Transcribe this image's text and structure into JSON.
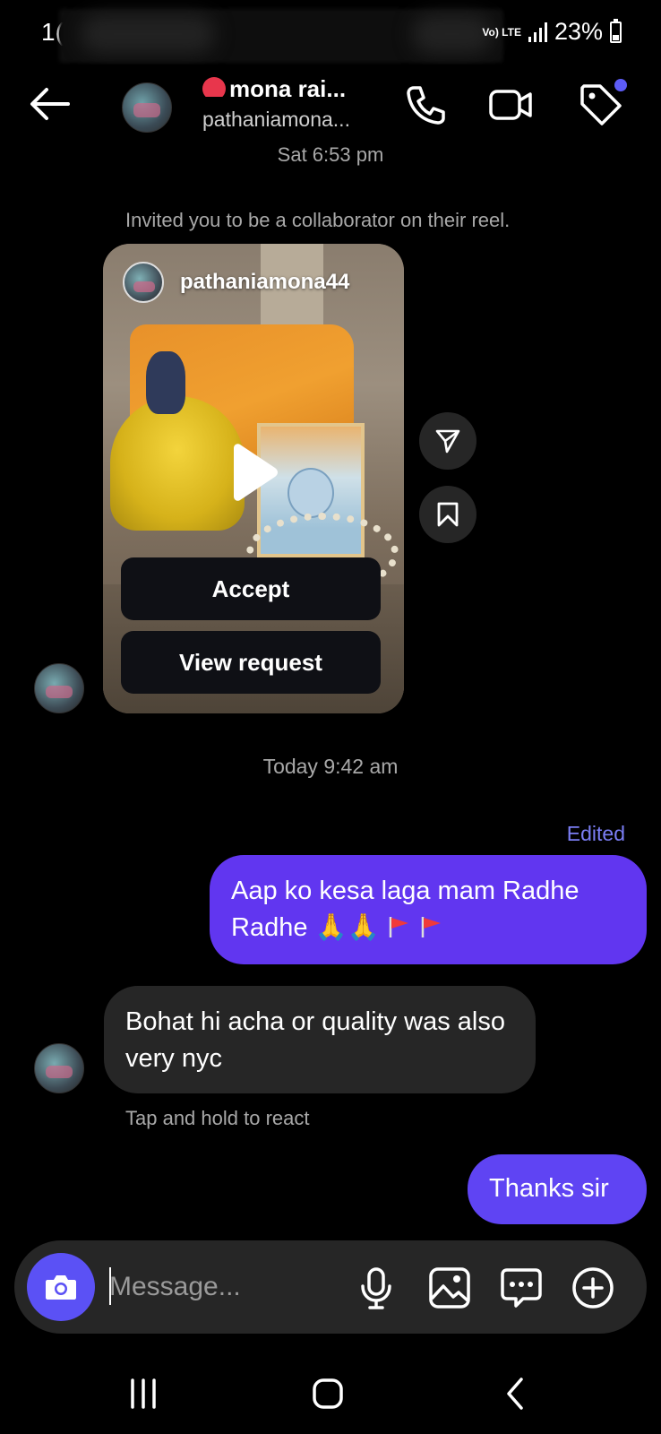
{
  "status_bar": {
    "time": "1(",
    "network_label": "Vo) LTE",
    "battery": "23%"
  },
  "header": {
    "name": "mona raj...",
    "username": "pathaniamona..."
  },
  "conversation": {
    "previous_timestamp": "Sat 6:53 pm",
    "invite_text": "Invited you to be a collaborator on their reel.",
    "reel": {
      "username": "pathaniamona44",
      "accept_label": "Accept",
      "view_request_label": "View request"
    },
    "today_timestamp": "Today 9:42 am",
    "edited_label": "Edited",
    "sent_message_1": "Aap ko kesa laga mam Radhe Radhe 🙏🙏",
    "received_message": "Bohat hi acha  or quality  was also very nyc",
    "react_hint": "Tap and hold to react",
    "sent_message_2": "Thanks sir"
  },
  "composer": {
    "placeholder": "Message..."
  },
  "colors": {
    "accent": "#5d5cf6",
    "sent_bubble": "#6136f0",
    "received_bubble": "#262626",
    "edited_text": "#7b7ef5"
  },
  "icons": {
    "header": [
      "arrow-left-icon",
      "phone-icon",
      "video-camera-icon",
      "tag-icon"
    ],
    "reel": [
      "play-icon",
      "send-icon",
      "bookmark-icon"
    ],
    "composer": [
      "camera-icon",
      "microphone-icon",
      "gallery-icon",
      "sticker-icon",
      "plus-circle-icon"
    ],
    "nav": [
      "recent-apps-icon",
      "home-icon",
      "back-icon"
    ]
  }
}
